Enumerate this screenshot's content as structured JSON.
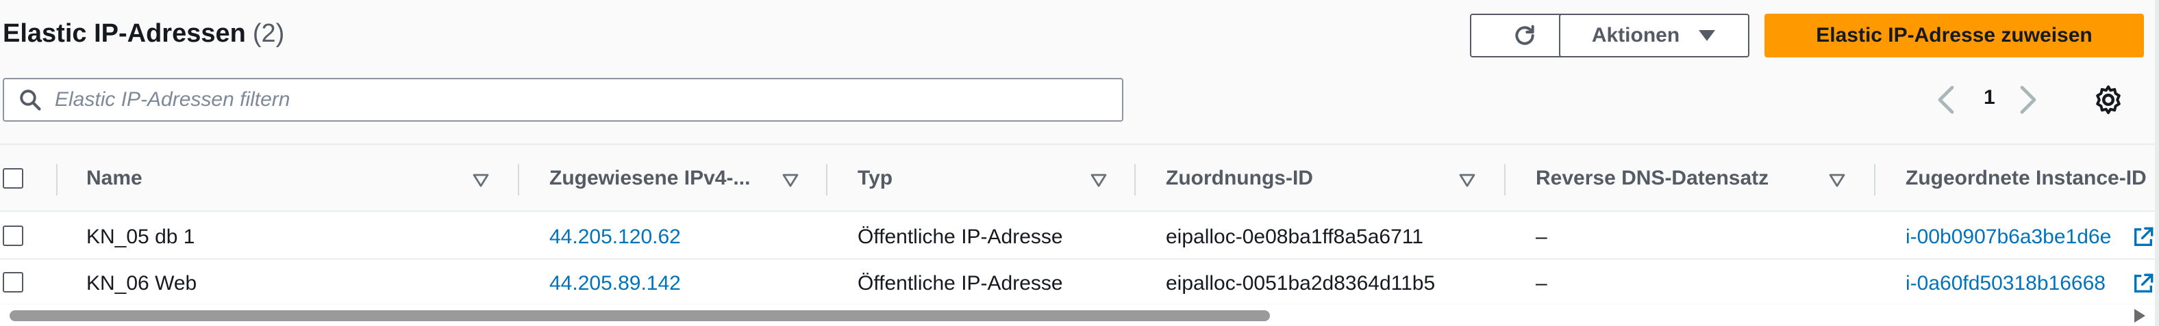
{
  "header": {
    "title": "Elastic IP-Adressen",
    "count": "(2)",
    "actions_label": "Aktionen",
    "allocate_label": "Elastic IP-Adresse zuweisen"
  },
  "search": {
    "placeholder": "Elastic IP-Adressen filtern",
    "value": ""
  },
  "pagination": {
    "current_page": "1"
  },
  "table": {
    "columns": [
      "Name",
      "Zugewiesene IPv4-...",
      "Typ",
      "Zuordnungs-ID",
      "Reverse DNS-Datensatz",
      "Zugeordnete Instance-ID"
    ],
    "rows": [
      {
        "name": "KN_05 db 1",
        "ipv4": "44.205.120.62",
        "type": "Öffentliche IP-Adresse",
        "allocation_id": "eipalloc-0e08ba1ff8a5a6711",
        "reverse_dns": "–",
        "instance_id": "i-00b0907b6a3be1d6e"
      },
      {
        "name": "KN_06 Web",
        "ipv4": "44.205.89.142",
        "type": "Öffentliche IP-Adresse",
        "allocation_id": "eipalloc-0051ba2d8364d11b5",
        "reverse_dns": "–",
        "instance_id": "i-0a60fd50318b16668"
      }
    ]
  },
  "colors": {
    "primary_button": "#ff9900",
    "link": "#0073bb",
    "text": "#16191f",
    "muted": "#545b64"
  },
  "icons": {
    "refresh": "refresh-icon",
    "caret": "caret-down-icon",
    "search": "search-icon",
    "prev": "chevron-left-icon",
    "next": "chevron-right-icon",
    "settings": "gear-icon",
    "sort": "sort-icon",
    "external": "external-link-icon"
  }
}
